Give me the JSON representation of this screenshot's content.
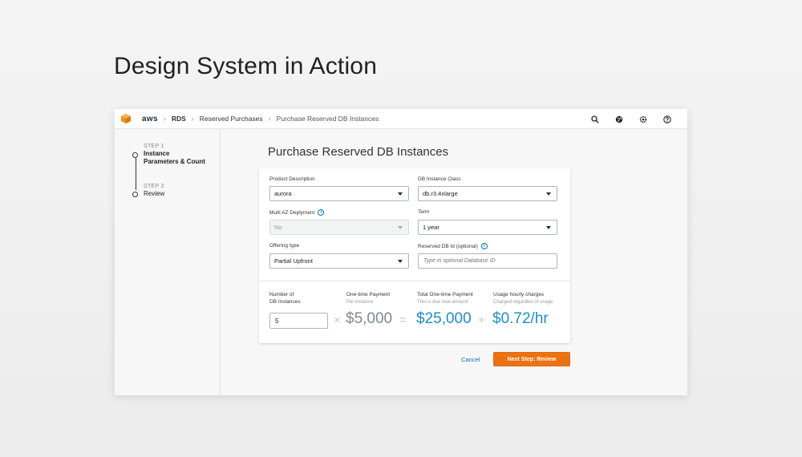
{
  "showcase": {
    "title": "Design System in Action"
  },
  "topbar": {
    "logo": "aws",
    "breadcrumbs": [
      "RDS",
      "Reserved Purchases",
      "Purchase Reserved DB Instances"
    ],
    "icons": [
      "search-icon",
      "globe-icon",
      "settings-icon",
      "help-icon"
    ]
  },
  "steps": [
    {
      "num": "STEP 1",
      "name": "Instance Parameters & Count",
      "active": true
    },
    {
      "num": "STEP 2",
      "name": "Review",
      "active": false
    }
  ],
  "page": {
    "heading": "Purchase Reserved DB Instances"
  },
  "form": {
    "product_description": {
      "label": "Product Description",
      "value": "aurora"
    },
    "db_instance_class": {
      "label": "DB Instance Class",
      "value": "db.r3.4xlarge"
    },
    "multi_az": {
      "label": "Multi AZ Deplyment",
      "value": "No",
      "disabled": true
    },
    "term": {
      "label": "Term",
      "value": "1 year"
    },
    "offering_type": {
      "label": "Offering type",
      "value": "Partial Upfront"
    },
    "reserved_db_id": {
      "label": "Reserved DB Id (optional)",
      "placeholder": "Type in optional Database ID"
    }
  },
  "calc": {
    "count_label_1": "Number of",
    "count_label_2": "DB Instances",
    "count_value": "5",
    "one_time": {
      "label": "One-time Payment",
      "sub": "Per instance",
      "value": "$5,000"
    },
    "total": {
      "label": "Total One-time Payment",
      "sub": "This is due now amount",
      "value": "$25,000"
    },
    "hourly": {
      "label": "Usage hourly charges",
      "sub": "Charged regardles of usage",
      "value": "$0.72/hr"
    },
    "op_multiply": "×",
    "op_equals": "=",
    "op_plus": "+"
  },
  "actions": {
    "cancel": "Cancel",
    "next": "Next Step: Review"
  },
  "colors": {
    "accent": "#ec7211",
    "link": "#0073bb",
    "value_blue": "#1f8ecd",
    "value_gray": "#7d8998"
  }
}
